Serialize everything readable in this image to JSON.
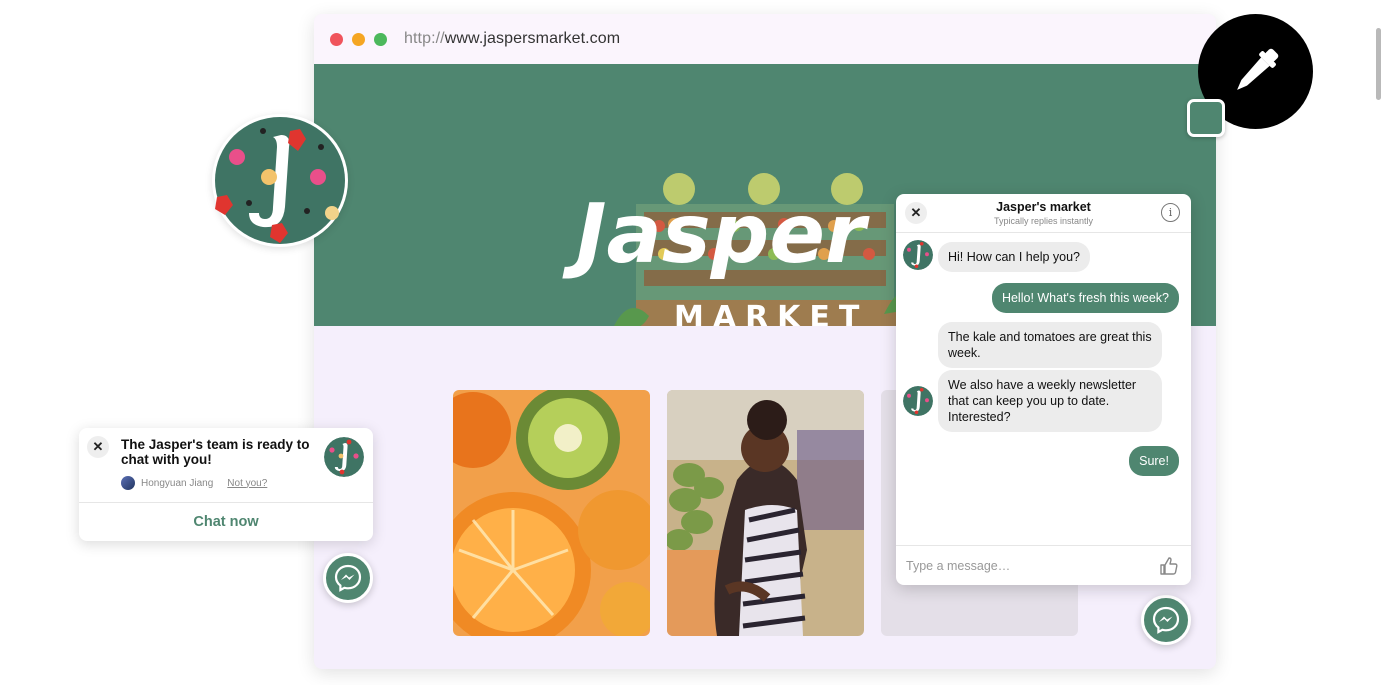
{
  "browser": {
    "url_protocol": "http://",
    "url_host": "www.jaspersmarket.com",
    "traffic_lights": [
      "#f0545c",
      "#f5a623",
      "#4cb85c"
    ]
  },
  "hero": {
    "logo_text": "Jasper",
    "logo_subtext": "MARKET",
    "background": "#4f8670"
  },
  "notification": {
    "close_icon": "close-icon",
    "message": "The Jasper's team is ready to chat with you!",
    "person_name": "Hongyuan Jiang",
    "not_you": "Not you?",
    "cta": "Chat now"
  },
  "chat": {
    "title": "Jasper's market",
    "subtitle": "Typically replies instantly",
    "messages": [
      {
        "from": "business",
        "text": "Hi! How can I help you?"
      },
      {
        "from": "user",
        "text": "Hello! What's fresh this week?"
      },
      {
        "from": "business",
        "text": "The kale and tomatoes are great this week."
      },
      {
        "from": "business",
        "text": "We also have a weekly newsletter that can keep you up to date. Interested?"
      },
      {
        "from": "user",
        "text": "Sure!"
      }
    ],
    "placeholder": "Type a message…"
  },
  "colors": {
    "brand_green": "#4f8670",
    "page_bg": "#f5effc"
  },
  "icons": [
    "eyedropper-icon",
    "messenger-icon",
    "info-icon",
    "thumbs-up-icon",
    "close-icon"
  ]
}
